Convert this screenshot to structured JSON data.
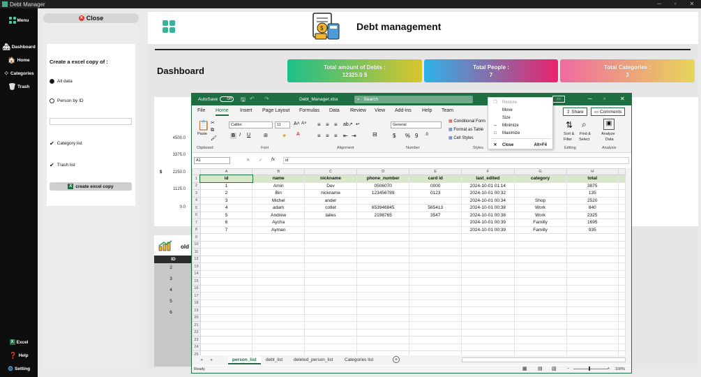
{
  "window": {
    "title": "Debt Manager"
  },
  "sidebar": {
    "menu": "Menu",
    "dashboard": "Dashboard",
    "home": "Home",
    "categories": "Categories",
    "trash": "Trash",
    "excel": "Excel",
    "help": "Help",
    "setting": "Setting"
  },
  "panel": {
    "close": "Close",
    "heading": "Create a excel copy of :",
    "all_data": "All data",
    "person_by_id": "Person by ID",
    "category_list": "Category list",
    "trash_list": "Trash list",
    "create_button": "create excel copy",
    "selected": "all_data"
  },
  "header": {
    "title": "Debt management"
  },
  "dashboard": {
    "title": "Dashboard"
  },
  "stats": [
    {
      "label": "Total amount of Debts :",
      "value": "12325.0 $"
    },
    {
      "label": "Total People :",
      "value": "7"
    },
    {
      "label": "Total Categories :",
      "value": "3"
    }
  ],
  "chart_data": {
    "type": "bar",
    "yticks": [
      "4500.0",
      "3375.0",
      "2250.0",
      "1125.0",
      "0.0"
    ],
    "ylabel": "$"
  },
  "oldest": {
    "title": "old",
    "id_header": "ID",
    "ids": [
      "2",
      "3",
      "4",
      "5",
      "6"
    ]
  },
  "excel": {
    "autosave": "AutoSave",
    "autosave_state": "Off",
    "filename": "Debt_Manager.xlsx",
    "search": "Search",
    "tabs": [
      "File",
      "Home",
      "Insert",
      "Page Layout",
      "Formulas",
      "Data",
      "Review",
      "View",
      "Add-ins",
      "Help",
      "Team"
    ],
    "active_tab": "Home",
    "share": "Share",
    "comments": "Comments",
    "font_name": "Calibri",
    "font_size": "11",
    "number_format": "General",
    "ribbon": {
      "paste": "Paste",
      "cond_format": "Conditional Form",
      "format_table": "Format as Table",
      "cell_styles": "Cell Styles",
      "sort_filter": "Sort &",
      "filter": "Filter",
      "find_select": "Find &",
      "select": "Select",
      "analyze": "Analyze",
      "analyze2": "Data"
    },
    "groups": [
      "Clipboard",
      "Font",
      "Alignment",
      "Number",
      "Styles",
      "Cells",
      "Editing",
      "Analysis"
    ],
    "name_box": "A1",
    "formula": "id",
    "columns": [
      "A",
      "B",
      "C",
      "D",
      "E",
      "F",
      "G",
      "H"
    ],
    "header_row": [
      "id",
      "name",
      "nickname",
      "phone_number",
      "card id",
      "last_edited",
      "category",
      "total"
    ],
    "rows": [
      [
        "1",
        "Amin",
        "Dev",
        "0506070",
        "0000",
        "2024-10-01 01:14",
        "",
        "3875"
      ],
      [
        "2",
        "Bin",
        "nickname",
        "123456789",
        "0123",
        "2024-10-01 00:32",
        "",
        "135"
      ],
      [
        "3",
        "Michel",
        "ander",
        "",
        "",
        "2024-10-01 00:34",
        "Shop",
        "2520"
      ],
      [
        "4",
        "adam",
        "cotlet",
        "653946845",
        "565413",
        "2024-10-01 00:38",
        "Work",
        "840"
      ],
      [
        "5",
        "Andrew",
        "tailes",
        "2198765",
        "3547",
        "2024-10-01 00:38",
        "Work",
        "2325"
      ],
      [
        "6",
        "Aycha",
        "",
        "",
        "",
        "2024-10-01 00:39",
        "Familly",
        "1695"
      ],
      [
        "7",
        "Ayman",
        "",
        "",
        "",
        "2024-10-01 00:39",
        "Familly",
        "935"
      ]
    ],
    "row_count": 25,
    "sheets": [
      "person_list",
      "debt_list",
      "deleted_person_list",
      "Categories list"
    ],
    "active_sheet": "person_list",
    "status": "Ready",
    "zoom": "100%"
  },
  "context_menu": {
    "items": [
      {
        "label": "Restore",
        "shortcut": "",
        "disabled": true,
        "icon": "restore-icon"
      },
      {
        "label": "Move",
        "shortcut": "",
        "disabled": false,
        "icon": ""
      },
      {
        "label": "Size",
        "shortcut": "",
        "disabled": false,
        "icon": ""
      },
      {
        "label": "Minimize",
        "shortcut": "",
        "disabled": false,
        "icon": "minimize-icon"
      },
      {
        "label": "Maximize",
        "shortcut": "",
        "disabled": false,
        "icon": "maximize-icon"
      },
      {
        "label": "Close",
        "shortcut": "Alt+F4",
        "disabled": false,
        "icon": "close-icon"
      }
    ]
  },
  "colors": {
    "excel_green": "#1e6e42",
    "sidebar": "#0d0d0d",
    "stat1": [
      "#1dbf8a",
      "#d9c52c"
    ],
    "stat2": [
      "#2db3e8",
      "#e8236a"
    ],
    "stat3": [
      "#f06aa0",
      "#e8d65a"
    ]
  }
}
